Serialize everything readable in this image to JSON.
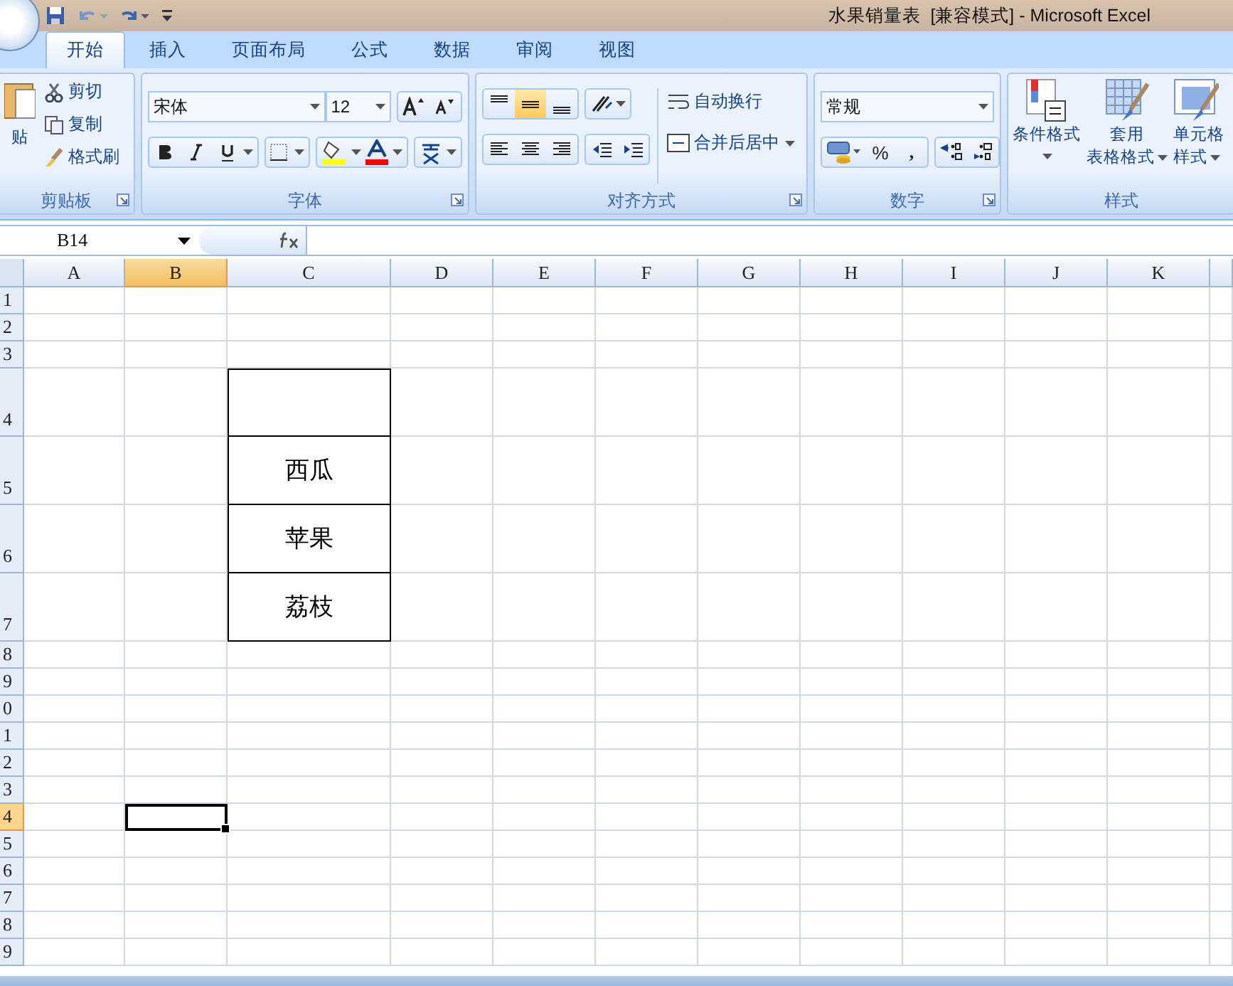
{
  "title_bar": {
    "title": "水果销量表  [兼容模式] - Microsoft Excel"
  },
  "ribbon_tabs": [
    {
      "label": "开始",
      "selected": true
    },
    {
      "label": "插入",
      "selected": false
    },
    {
      "label": "页面布局",
      "selected": false
    },
    {
      "label": "公式",
      "selected": false
    },
    {
      "label": "数据",
      "selected": false
    },
    {
      "label": "审阅",
      "selected": false
    },
    {
      "label": "视图",
      "selected": false
    }
  ],
  "clipboard": {
    "paste": "贴",
    "cut": "剪切",
    "copy": "复制",
    "format_painter": "格式刷",
    "label": "剪贴板"
  },
  "font": {
    "name": "宋体",
    "size": "12",
    "label": "字体"
  },
  "alignment": {
    "wrap": "自动换行",
    "merge": "合并后居中",
    "label": "对齐方式"
  },
  "number": {
    "format": "常规",
    "percent": "%",
    "comma": ",",
    "label": "数字"
  },
  "styles": {
    "conditional": "条件格式",
    "table_1": "套用",
    "table_2": "表格格式",
    "cell_1": "单元格",
    "cell_2": "样式",
    "label": "样式"
  },
  "name_box": "B14",
  "columns": [
    {
      "label": "A",
      "selected": false
    },
    {
      "label": "B",
      "selected": true
    },
    {
      "label": "C",
      "selected": false
    },
    {
      "label": "D",
      "selected": false
    },
    {
      "label": "E",
      "selected": false
    },
    {
      "label": "F",
      "selected": false
    },
    {
      "label": "G",
      "selected": false
    },
    {
      "label": "H",
      "selected": false
    },
    {
      "label": "I",
      "selected": false
    },
    {
      "label": "J",
      "selected": false
    },
    {
      "label": "K",
      "selected": false
    }
  ],
  "rows": [
    {
      "label": "1",
      "tall": false,
      "selected": false,
      "boxed": false
    },
    {
      "label": "2",
      "tall": false,
      "selected": false,
      "boxed": false
    },
    {
      "label": "3",
      "tall": false,
      "selected": false,
      "boxed": false
    },
    {
      "label": "4",
      "tall": true,
      "selected": false,
      "boxed": true
    },
    {
      "label": "5",
      "tall": true,
      "selected": false,
      "boxed": true,
      "text": "西瓜"
    },
    {
      "label": "6",
      "tall": true,
      "selected": false,
      "boxed": true,
      "text": "苹果"
    },
    {
      "label": "7",
      "tall": true,
      "selected": false,
      "boxed": true,
      "text": "荔枝"
    },
    {
      "label": "8",
      "tall": false,
      "selected": false,
      "boxed": false
    },
    {
      "label": "9",
      "tall": false,
      "selected": false,
      "boxed": false
    },
    {
      "label": "0",
      "tall": false,
      "selected": false,
      "boxed": false
    },
    {
      "label": "1",
      "tall": false,
      "selected": false,
      "boxed": false
    },
    {
      "label": "2",
      "tall": false,
      "selected": false,
      "boxed": false
    },
    {
      "label": "3",
      "tall": false,
      "selected": false,
      "boxed": false
    },
    {
      "label": "4",
      "tall": false,
      "selected": true,
      "boxed": false
    },
    {
      "label": "5",
      "tall": false,
      "selected": false,
      "boxed": false
    },
    {
      "label": "6",
      "tall": false,
      "selected": false,
      "boxed": false
    },
    {
      "label": "7",
      "tall": false,
      "selected": false,
      "boxed": false
    },
    {
      "label": "8",
      "tall": false,
      "selected": false,
      "boxed": false
    },
    {
      "label": "9",
      "tall": false,
      "selected": false,
      "boxed": false
    }
  ]
}
